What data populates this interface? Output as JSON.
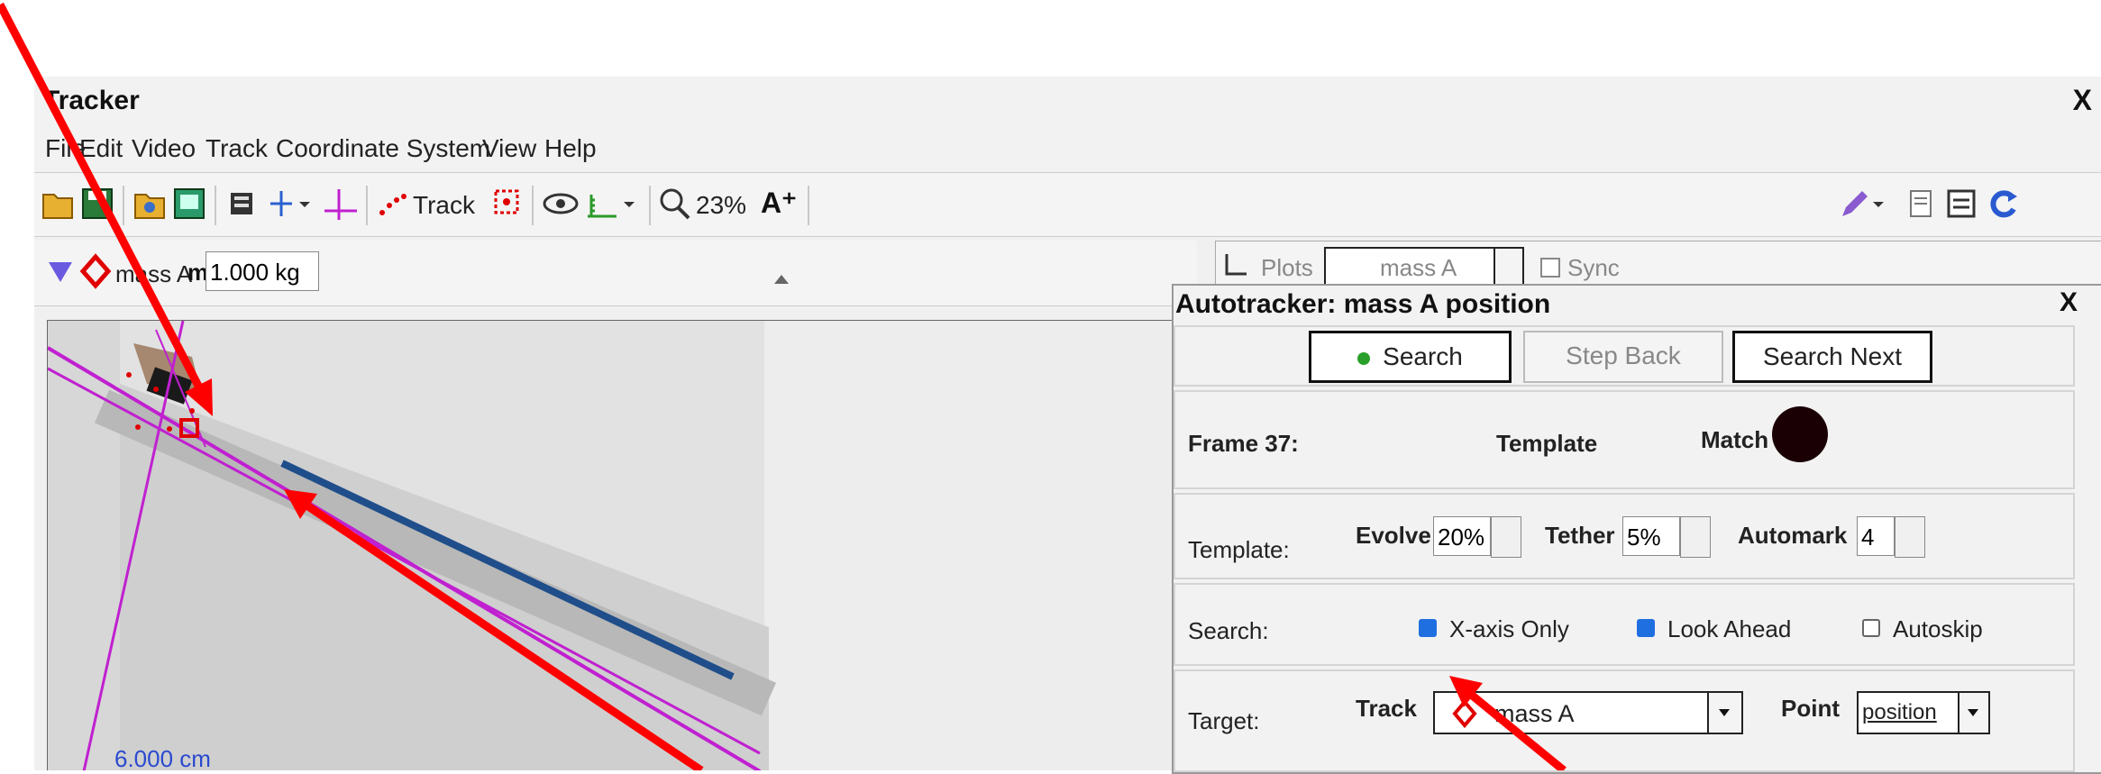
{
  "window": {
    "title": "Tracker",
    "close_label": "X"
  },
  "menu": [
    "File",
    "Edit",
    "Video",
    "Track",
    "Coordinate System",
    "View",
    "Help"
  ],
  "toolbar": {
    "track_label": "Track",
    "zoom_label": "23%",
    "font_size_label": "A⁺"
  },
  "track_props": {
    "track_name": "mass A",
    "mass_label": "m",
    "mass_value": "1.000 kg"
  },
  "right_panel": {
    "plots_label": "Plots",
    "track_combo": "mass A",
    "sync_label": "Sync"
  },
  "video": {
    "scale_label": "6.000 cm"
  },
  "autotracker": {
    "title": "Autotracker: mass A position",
    "close_label": "X",
    "buttons": {
      "search": "Search",
      "step_back": "Step Back",
      "search_next": "Search Next"
    },
    "frame_label": "Frame 37:",
    "template_heading": "Template",
    "match_heading": "Match",
    "template_label": "Template:",
    "evolve": {
      "label": "Evolve",
      "value": "20%"
    },
    "tether": {
      "label": "Tether",
      "value": "5%"
    },
    "automark": {
      "label": "Automark",
      "value": "4"
    },
    "search_label": "Search:",
    "options": {
      "x_axis_only": {
        "label": "X-axis Only",
        "checked": true
      },
      "look_ahead": {
        "label": "Look Ahead",
        "checked": true
      },
      "autoskip": {
        "label": "Autoskip",
        "checked": false
      }
    },
    "target_label": "Target:",
    "target_track_label": "Track",
    "target_track_value": "mass A",
    "target_point_label": "Point",
    "target_point_value": "position"
  },
  "colors": {
    "annotation_arrow": "#ff0000",
    "axis_line": "#c020d0",
    "track_marker": "#e00000",
    "checkbox": "#1f6fe0"
  }
}
